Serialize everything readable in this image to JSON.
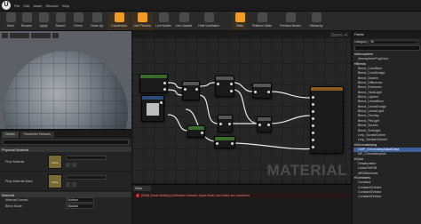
{
  "menu": [
    "File",
    "Edit",
    "Asset",
    "Window",
    "Help"
  ],
  "toolbar": {
    "buttons": [
      "Save",
      "Browse",
      "Apply",
      "Search",
      "Home",
      "Clean Up",
      "Connectors",
      "Live Preview",
      "Live Nodes",
      "Live Update",
      "Hide Unrelated",
      "Stats",
      "Platform Stats",
      "Preview Nodes",
      "Hierarchy"
    ]
  },
  "viewport": {},
  "details": {
    "tabs": [
      "Details",
      "Parameter Defaults"
    ],
    "section_physical": "Physical Material",
    "phys_rows": [
      {
        "label": "Phys Material",
        "thumb": "None"
      },
      {
        "label": "Phys Material Mask",
        "thumb": "None"
      }
    ],
    "section_material": "Material",
    "material_rows": [
      {
        "label": "Material Domain",
        "value": "Surface"
      },
      {
        "label": "Blend Mode",
        "value": "Masked"
      }
    ]
  },
  "graph": {
    "zoom": "Zoom -4",
    "watermark": "MATERIAL",
    "colors": {
      "header_green": "#3b6b2a",
      "header_blue": "#2c4b7a",
      "header_gray": "#555555",
      "header_orange": "#8a5a1e",
      "wire": "#e8e8e8"
    }
  },
  "stats": {
    "tab": "Stats",
    "message": "[SM5] (Node Multiply) Arithmetic between types float2 and float4 are undefined"
  },
  "palette": {
    "title": "Palette",
    "category_label": "Category",
    "category_value": "All",
    "items": [
      {
        "text": "Atmosphere",
        "type": "cat"
      },
      {
        "text": "AtmosphereFogColor",
        "type": "item"
      },
      {
        "text": "Blends",
        "type": "cat"
      },
      {
        "text": "Blend_ColorBurn",
        "type": "item"
      },
      {
        "text": "Blend_ColorDodge",
        "type": "item"
      },
      {
        "text": "Blend_Darken",
        "type": "item"
      },
      {
        "text": "Blend_Difference",
        "type": "item"
      },
      {
        "text": "Blend_Exclusion",
        "type": "item"
      },
      {
        "text": "Blend_HardLight",
        "type": "item"
      },
      {
        "text": "Blend_Lighten",
        "type": "item"
      },
      {
        "text": "Blend_LinearBurn",
        "type": "item"
      },
      {
        "text": "Blend_LinearDodge",
        "type": "item"
      },
      {
        "text": "Blend_LinearLight",
        "type": "item"
      },
      {
        "text": "Blend_Overlay",
        "type": "item"
      },
      {
        "text": "Blend_PinLight",
        "type": "item"
      },
      {
        "text": "Blend_Screen",
        "type": "item"
      },
      {
        "text": "Blend_SoftLight",
        "type": "item"
      },
      {
        "text": "Lerp_ScratchGrime",
        "type": "item"
      },
      {
        "text": "Lerp_ScratchGrime2",
        "type": "item"
      },
      {
        "text": "Chromakeying",
        "type": "cat"
      },
      {
        "text": "CMP_ChromakeyAdjustDispl",
        "type": "sel"
      },
      {
        "text": "MF_ChromakeyAdv",
        "type": "item"
      },
      {
        "text": "Color",
        "type": "cat"
      },
      {
        "text": "Desaturation",
        "type": "item"
      },
      {
        "text": "LinearToHSB",
        "type": "item"
      },
      {
        "text": "sRGBtoLinear",
        "type": "item"
      },
      {
        "text": "Constants",
        "type": "cat"
      },
      {
        "text": "Constant",
        "type": "item"
      },
      {
        "text": "Constant2Vector",
        "type": "item"
      },
      {
        "text": "Constant3Vector",
        "type": "item"
      },
      {
        "text": "Constant4Vector",
        "type": "item"
      }
    ]
  }
}
